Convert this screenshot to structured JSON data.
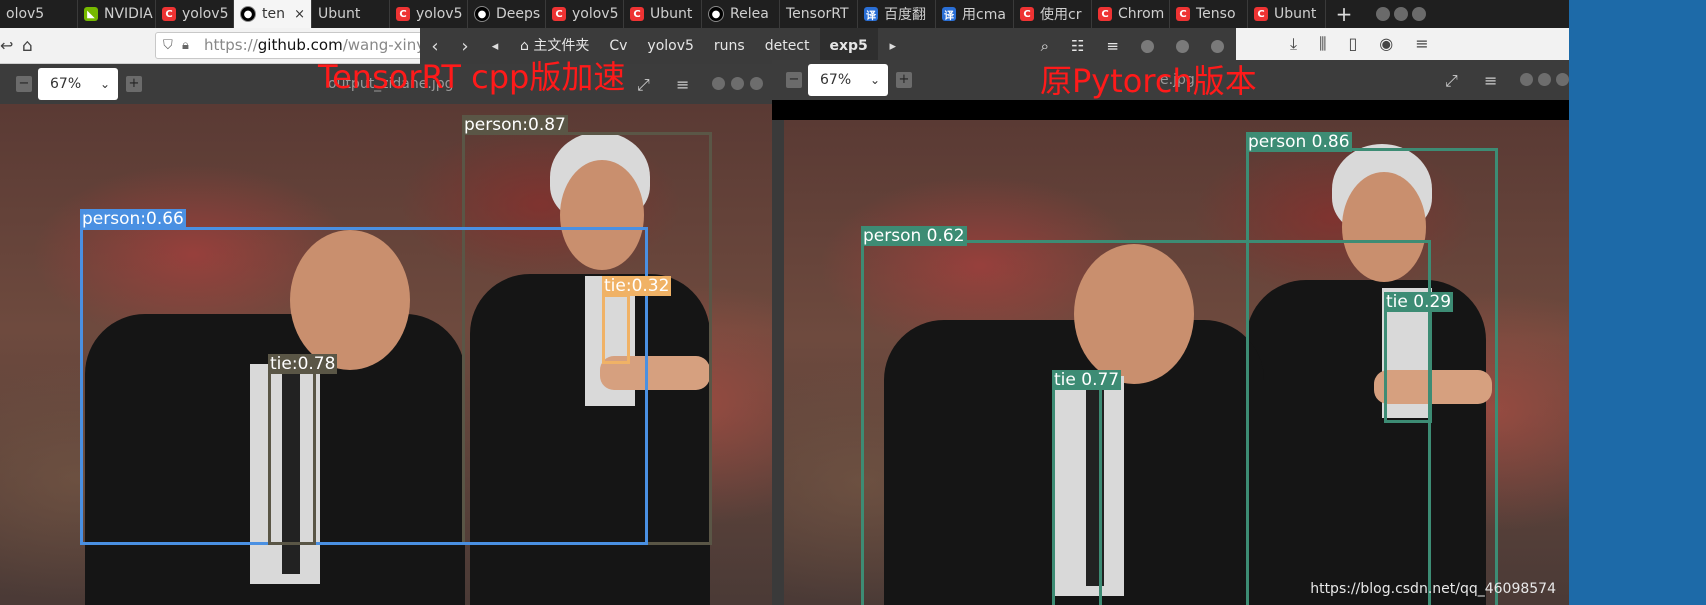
{
  "browser": {
    "tabs": [
      {
        "label": "olov5",
        "icon": "none"
      },
      {
        "label": "NVIDIA",
        "icon": "nvidia-icon"
      },
      {
        "label": "yolov5",
        "icon": "csdn-icon"
      },
      {
        "label": "ten",
        "icon": "github-icon",
        "active": true
      },
      {
        "label": "Ubunt",
        "icon": "none"
      },
      {
        "label": "yolov5",
        "icon": "csdn-icon"
      },
      {
        "label": "Deeps",
        "icon": "github-icon"
      },
      {
        "label": "yolov5",
        "icon": "csdn-icon"
      },
      {
        "label": "Ubunt",
        "icon": "csdn-icon"
      },
      {
        "label": "Relea",
        "icon": "github-icon"
      },
      {
        "label": "TensorRT",
        "icon": "none"
      },
      {
        "label": "百度翻",
        "icon": "baidu-icon"
      },
      {
        "label": "用cma",
        "icon": "baidu-icon"
      },
      {
        "label": "使用cr",
        "icon": "csdn-icon"
      },
      {
        "label": "Chrom",
        "icon": "csdn-icon"
      },
      {
        "label": "Tenso",
        "icon": "csdn-icon"
      },
      {
        "label": "Ubunt",
        "icon": "csdn-icon"
      }
    ],
    "new_tab": "+",
    "close_tab": "×",
    "url_prefix": "https://",
    "url_host": "github.com",
    "url_path": "/wang-xinyu/"
  },
  "file_manager": {
    "breadcrumbs": [
      "主文件夹",
      "Cv",
      "yolov5",
      "runs",
      "detect",
      "exp5"
    ],
    "active_crumb": "exp5"
  },
  "viewer_left": {
    "zoom": "67%",
    "title": "output_zidane.jpg",
    "detections": [
      {
        "label": "person:0.87",
        "color": "#5a5646"
      },
      {
        "label": "person:0.66",
        "color": "#4a90e2"
      },
      {
        "label": "tie:0.32",
        "color": "#f0b266"
      },
      {
        "label": "tie:0.78",
        "color": "#5a5646"
      }
    ]
  },
  "viewer_right": {
    "zoom": "67%",
    "title": "e.jpg",
    "detections": [
      {
        "label": "person 0.86",
        "color": "#3d8c74"
      },
      {
        "label": "person 0.62",
        "color": "#3d8c74"
      },
      {
        "label": "tie 0.29",
        "color": "#3d8c74"
      },
      {
        "label": "tie 0.77",
        "color": "#3d8c74"
      }
    ]
  },
  "annotations": {
    "left_caption": "TensorRT cpp版加速",
    "right_caption": "原Pytorch版本",
    "watermark": "https://blog.csdn.net/qq_46098574"
  }
}
